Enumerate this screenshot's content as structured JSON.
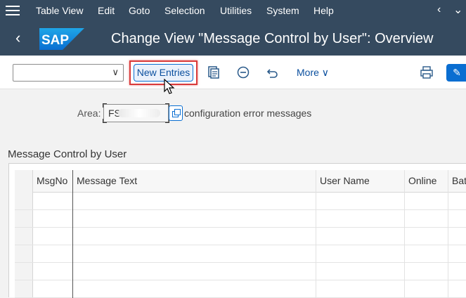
{
  "menubar": {
    "items": [
      "Table View",
      "Edit",
      "Goto",
      "Selection",
      "Utilities",
      "System",
      "Help"
    ]
  },
  "titlebar": {
    "logo_text": "SAP",
    "title": "Change View \"Message Control by User\": Overview"
  },
  "toolbar": {
    "combo_value": "",
    "new_entries_label": "New Entries",
    "more_label": "More"
  },
  "area": {
    "label": "Area:",
    "value": "FS",
    "description": "configuration error messages"
  },
  "section": {
    "title": "Message Control by User"
  },
  "table": {
    "columns": [
      "MsgNo",
      "Message Text",
      "User Name",
      "Online",
      "Bat"
    ],
    "rows": []
  },
  "colors": {
    "shell": "#354a5f",
    "accent": "#0a6ed1",
    "highlight": "#d93a3a"
  }
}
